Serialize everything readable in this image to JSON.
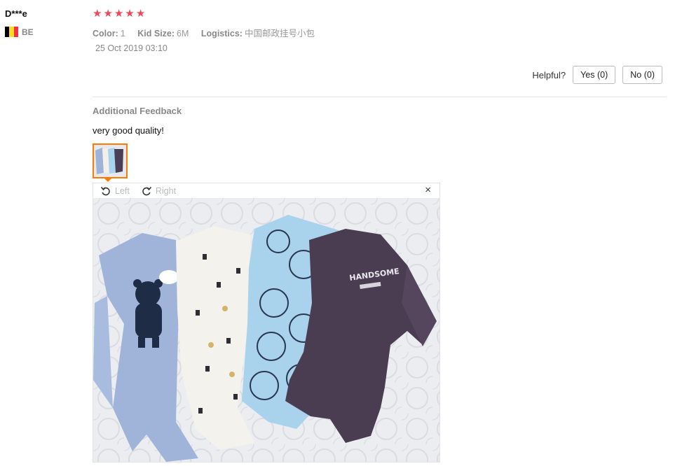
{
  "review": {
    "username": "D***e",
    "country_code": "BE",
    "rating": 5,
    "sku": {
      "color_key": "Color:",
      "color_val": "1",
      "size_key": "Kid Size:",
      "size_val": "6M",
      "logistics_key": "Logistics:",
      "logistics_val": "中国邮政挂号小包"
    },
    "date": "25 Oct 2019 03:10"
  },
  "helpful": {
    "label": "Helpful?",
    "yes": "Yes (0)",
    "no": "No (0)"
  },
  "additional": {
    "title": "Additional Feedback",
    "text": "very good quality!"
  },
  "viewer": {
    "rotate_left": "Left",
    "rotate_right": "Right",
    "close": "×"
  },
  "colors": {
    "star": "#f0465a",
    "thumb_border": "#ff7a00",
    "flag": [
      "#000000",
      "#fdda24",
      "#ef3340"
    ]
  },
  "icons": [
    "star-icon",
    "rotate-left-icon",
    "rotate-right-icon",
    "close-icon"
  ]
}
